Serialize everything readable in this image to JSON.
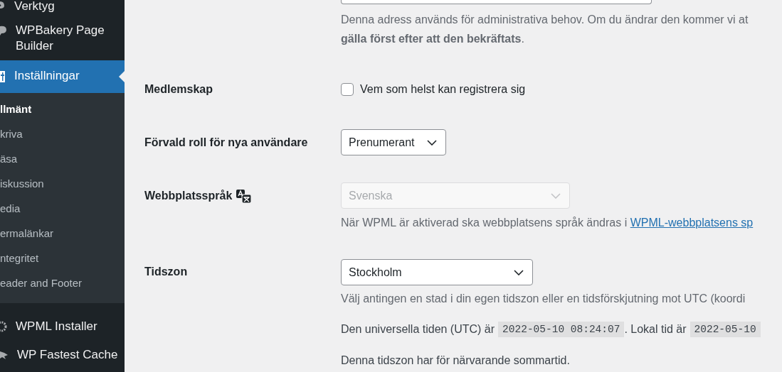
{
  "sidebar": {
    "menu_top": [
      {
        "label": "Verktyg",
        "selected": false
      },
      {
        "label": "WPBakery Page Builder",
        "selected": false
      },
      {
        "label": "Inställningar",
        "selected": true
      }
    ],
    "submenu": [
      {
        "label": "llmänt",
        "selected": true
      },
      {
        "label": "kriva",
        "selected": false
      },
      {
        "label": "äsa",
        "selected": false
      },
      {
        "label": "iskussion",
        "selected": false
      },
      {
        "label": "edia",
        "selected": false
      },
      {
        "label": "ermalänkar",
        "selected": false
      },
      {
        "label": "ntegritet",
        "selected": false
      },
      {
        "label": "eader and Footer",
        "selected": false
      }
    ],
    "menu_bottom": [
      {
        "label": "WPML Installer",
        "selected": false
      },
      {
        "label": "WP Fastest Cache",
        "selected": false
      }
    ]
  },
  "email_description": {
    "lines": [
      "Denna adress används för administrativa behov. Om du ändrar den kommer vi at",
      "**gälla först efter att den bekräftats**."
    ]
  },
  "membership": {
    "label": "Medlemskap",
    "checkbox_label": "Vem som helst kan registrera sig",
    "checked": false
  },
  "default_role": {
    "label": "Förvald roll för nya användare",
    "value": "Prenumerant"
  },
  "site_language": {
    "label": "Webbplatsspråk",
    "value": "Svenska",
    "disabled": true,
    "help": "När WPML är aktiverad ska webbplatsens språk ändras i",
    "link": "WPML-webbplatsens sp"
  },
  "timezone": {
    "label": "Tidszon",
    "value": "Stockholm",
    "help": "Välj antingen en stad i din egen tidszon eller en tidsförskjutning mot UTC (koordi",
    "utc_label": "Den universella tiden (UTC) är",
    "utc_time": "2022-05-10 08:24:07",
    "local_label": ". Lokal tid är",
    "local_time": "2022-05-10",
    "dst_note": "Denna tidszon har för närvarande sommartid."
  }
}
